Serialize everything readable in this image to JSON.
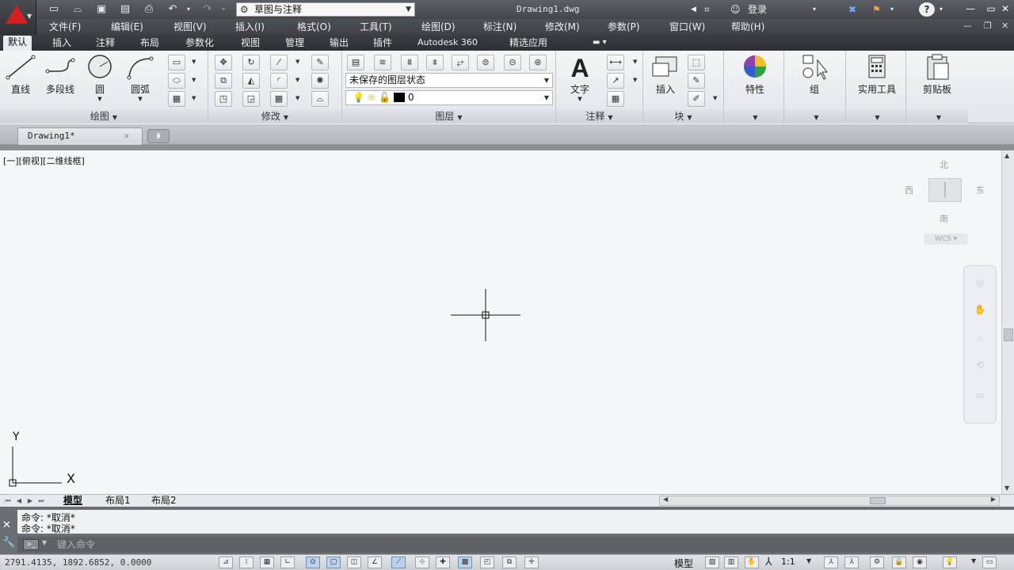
{
  "titlebar": {
    "workspace": "草图与注释",
    "document_title": "Drawing1.dwg",
    "login": "登录",
    "help": "?"
  },
  "menubar": {
    "items": [
      "文件(F)",
      "编辑(E)",
      "视图(V)",
      "插入(I)",
      "格式(O)",
      "工具(T)",
      "绘图(D)",
      "标注(N)",
      "修改(M)",
      "参数(P)",
      "窗口(W)",
      "帮助(H)"
    ]
  },
  "ribbon_tabs": [
    "默认",
    "插入",
    "注释",
    "布局",
    "参数化",
    "视图",
    "管理",
    "输出",
    "插件",
    "Autodesk 360",
    "精选应用"
  ],
  "ribbon": {
    "draw_panel": {
      "title": "绘图",
      "tools": [
        "直线",
        "多段线",
        "圆",
        "圆弧"
      ]
    },
    "modify_panel": {
      "title": "修改"
    },
    "layer_panel": {
      "title": "图层",
      "layer_state": "未保存的图层状态",
      "current_layer": "0"
    },
    "annotation_panel": {
      "title": "注释",
      "text_tool": "文字"
    },
    "block_panel": {
      "title": "块",
      "insert_tool": "插入"
    },
    "properties": "特性",
    "group": "组",
    "utilities": "实用工具",
    "clipboard": "剪贴板"
  },
  "file_tab": {
    "name": "Drawing1*"
  },
  "viewport": {
    "label": "[一][俯视][二维线框]",
    "viewcube": {
      "north": "北",
      "south": "南",
      "east": "东",
      "west": "西",
      "wcs": "WCS"
    },
    "ucs_x": "X",
    "ucs_y": "Y"
  },
  "layout_tabs": [
    "模型",
    "布局1",
    "布局2"
  ],
  "command": {
    "history": [
      "命令: *取消*",
      "命令: *取消*"
    ],
    "placeholder": "键入命令"
  },
  "statusbar": {
    "coordinates": "2791.4135, 1892.6852, 0.0000",
    "model": "模型",
    "scale": "1:1"
  },
  "colors": {
    "accent_red": "#d42020",
    "titlebar": "#4d5055",
    "ribbon_bg": "#eceef1"
  }
}
